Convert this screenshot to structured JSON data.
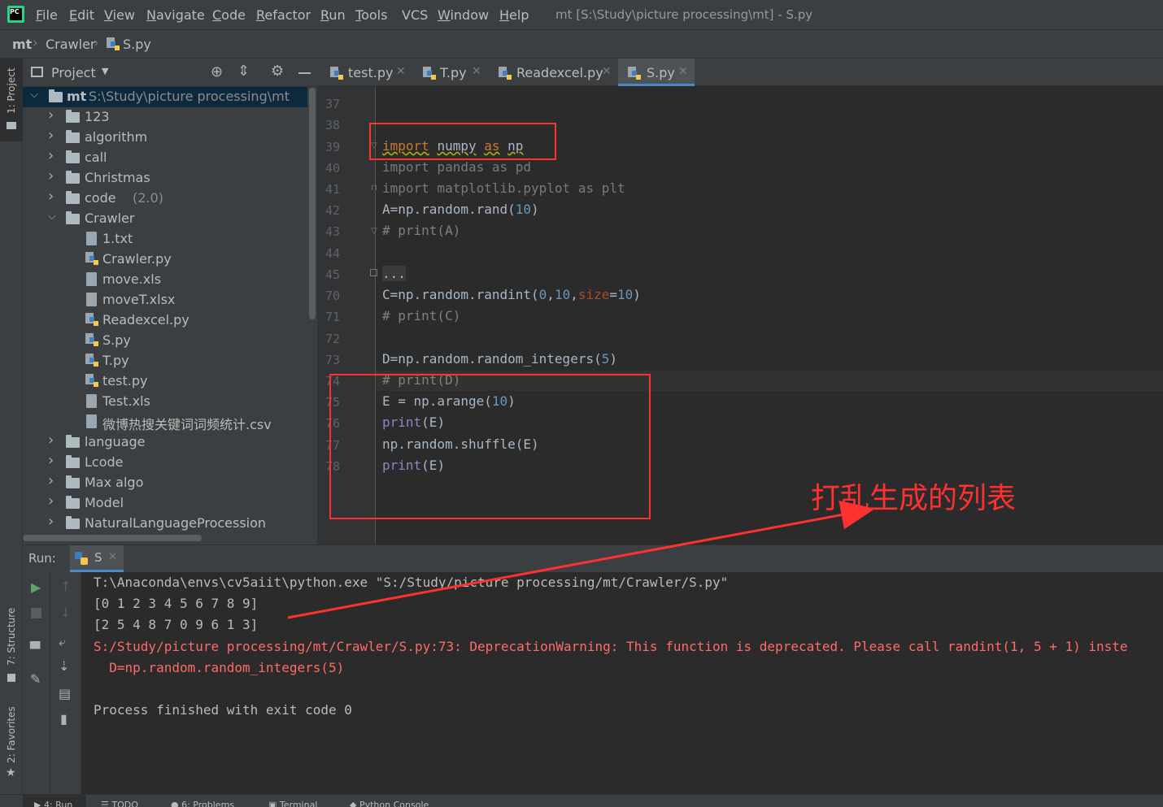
{
  "menubar": {
    "logo": "PC",
    "items": [
      {
        "label": "File",
        "mnemonic": "F",
        "rest": "ile"
      },
      {
        "label": "Edit",
        "mnemonic": "E",
        "rest": "dit"
      },
      {
        "label": "View",
        "mnemonic": "V",
        "rest": "iew"
      },
      {
        "label": "Navigate",
        "mnemonic": "N",
        "rest": "avigate"
      },
      {
        "label": "Code",
        "mnemonic": "C",
        "rest": "ode"
      },
      {
        "label": "Refactor",
        "mnemonic": "R",
        "rest": "efactor"
      },
      {
        "label": "Run",
        "mnemonic": "R",
        "rest": "un"
      },
      {
        "label": "Tools",
        "mnemonic": "T",
        "rest": "ools"
      },
      {
        "label": "VCS",
        "mnemonic": "",
        "rest": "VCS"
      },
      {
        "label": "Window",
        "mnemonic": "W",
        "rest": "indow"
      },
      {
        "label": "Help",
        "mnemonic": "H",
        "rest": "elp"
      }
    ],
    "window_title": "mt [S:\\Study\\picture processing\\mt] - S.py"
  },
  "breadcrumb": [
    "mt",
    "Crawler",
    "S.py"
  ],
  "left_strip": {
    "project_tab": "1: Project",
    "structure_tab": "7: Structure",
    "favorites_tab": "2: Favorites"
  },
  "project_panel": {
    "title": "Project",
    "root": {
      "name": "mt",
      "path": "S:\\Study\\picture processing\\mt"
    },
    "rows": [
      {
        "name": "123",
        "kind": "folder",
        "hint": ""
      },
      {
        "name": "algorithm",
        "kind": "folder",
        "hint": ""
      },
      {
        "name": "call",
        "kind": "folder",
        "hint": ""
      },
      {
        "name": "Christmas",
        "kind": "folder",
        "hint": ""
      },
      {
        "name": "code",
        "kind": "folder",
        "hint": "(2.0)"
      },
      {
        "name": "Crawler",
        "kind": "folder-open",
        "hint": ""
      },
      {
        "name": "1.txt",
        "kind": "file",
        "hint": ""
      },
      {
        "name": "Crawler.py",
        "kind": "py",
        "hint": ""
      },
      {
        "name": "move.xls",
        "kind": "file",
        "hint": ""
      },
      {
        "name": "moveT.xlsx",
        "kind": "file",
        "hint": ""
      },
      {
        "name": "Readexcel.py",
        "kind": "py",
        "hint": ""
      },
      {
        "name": "S.py",
        "kind": "py",
        "hint": ""
      },
      {
        "name": "T.py",
        "kind": "py",
        "hint": ""
      },
      {
        "name": "test.py",
        "kind": "py",
        "hint": ""
      },
      {
        "name": "Test.xls",
        "kind": "file",
        "hint": ""
      },
      {
        "name": "微博热搜关键词词频统计.csv",
        "kind": "file",
        "hint": ""
      },
      {
        "name": "language",
        "kind": "folder",
        "hint": ""
      },
      {
        "name": "Lcode",
        "kind": "folder",
        "hint": ""
      },
      {
        "name": "Max algo",
        "kind": "folder",
        "hint": ""
      },
      {
        "name": "Model",
        "kind": "folder",
        "hint": ""
      },
      {
        "name": "NaturalLanguageProcession",
        "kind": "folder",
        "hint": ""
      }
    ]
  },
  "editor_tabs": [
    "test.py",
    "T.py",
    "Readexcel.py",
    "S.py"
  ],
  "editor": {
    "line_numbers": [
      "37",
      "38",
      "39",
      "40",
      "41",
      "42",
      "43",
      "44",
      "45",
      "70",
      "71",
      "72",
      "73",
      "74",
      "75",
      "76",
      "77",
      "78"
    ],
    "code": {
      "l39_kw": "import",
      "l39_mod": "numpy",
      "l39_as": "as",
      "l39_alias": "np",
      "l40": "import pandas as pd",
      "l41": "import matplotlib.pyplot as plt",
      "l42_a": "A=np.random.rand(",
      "l42_n": "10",
      "l42_b": ")",
      "l43": "# print(A)",
      "l45": "...",
      "l70_a": "C=np.random.randint(",
      "l70_n1": "0",
      "l70_c1": ",",
      "l70_n2": "10",
      "l70_c2": ",",
      "l70_p": "size",
      "l70_eq": "=",
      "l70_n3": "10",
      "l70_b": ")",
      "l71": "# print(C)",
      "l73_a": "D=np.random.random_integers(",
      "l73_n": "5",
      "l73_b": ")",
      "l74": "# print(D)",
      "l75_a": "E = np.arange(",
      "l75_n": "10",
      "l75_b": ")",
      "l76_f": "print",
      "l76_b": "(E)",
      "l77": "np.random.shuffle(E)",
      "l78_f": "print",
      "l78_b": "(E)"
    }
  },
  "annotation": "打乱生成的列表",
  "run_panel": {
    "label": "Run:",
    "tab": "S",
    "lines": [
      {
        "text": "T:\\Anaconda\\envs\\cv5aiit\\python.exe \"S:/Study/picture processing/mt/Crawler/S.py\"",
        "kind": "normal"
      },
      {
        "text": "[0 1 2 3 4 5 6 7 8 9]",
        "kind": "normal"
      },
      {
        "text": "[2 5 4 8 7 0 9 6 1 3]",
        "kind": "normal"
      },
      {
        "text": "S:/Study/picture processing/mt/Crawler/S.py:73: DeprecationWarning: This function is deprecated. Please call randint(1, 5 + 1) inste",
        "kind": "error"
      },
      {
        "text": "  D=np.random.random_integers(5)",
        "kind": "error"
      },
      {
        "text": "",
        "kind": "normal"
      },
      {
        "text": "Process finished with exit code 0",
        "kind": "normal"
      }
    ]
  },
  "bottom_tabs": [
    "4: Run",
    "TODO",
    "6: Problems",
    "Terminal",
    "Python Console"
  ],
  "colors": {
    "accent": "#4a88c7",
    "annotation_red": "#ff3030",
    "error_text": "#ff6b68"
  }
}
